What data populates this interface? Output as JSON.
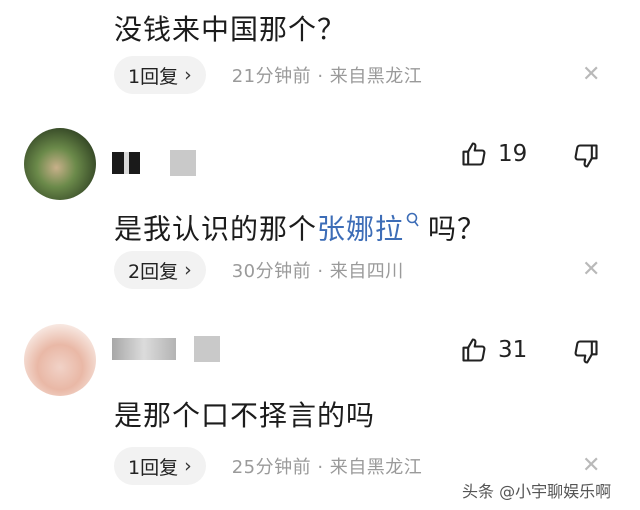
{
  "comments": [
    {
      "text": "没钱来中国那个？",
      "reply_label": "1回复",
      "meta": "21分钟前 · 来自黑龙江"
    },
    {
      "text_before": "是我认识的那个",
      "mention": "张娜拉",
      "text_after": "吗？",
      "likes": "19",
      "reply_label": "2回复",
      "meta": "30分钟前 · 来自四川"
    },
    {
      "text": "是那个口不择言的吗",
      "likes": "31",
      "reply_label": "1回复",
      "meta": "25分钟前 · 来自黑龙江"
    }
  ],
  "icons": {
    "like": "thumbs-up-icon",
    "dislike": "thumbs-down-icon",
    "close": "close-icon",
    "mention_search": "search-icon",
    "reply_chevron": "chevron-right-icon"
  },
  "colors": {
    "mention": "#3d6db7",
    "meta_gray": "#9a9a9a",
    "pill_bg": "#f2f2f2"
  },
  "watermark": "头条 @小宇聊娱乐啊"
}
